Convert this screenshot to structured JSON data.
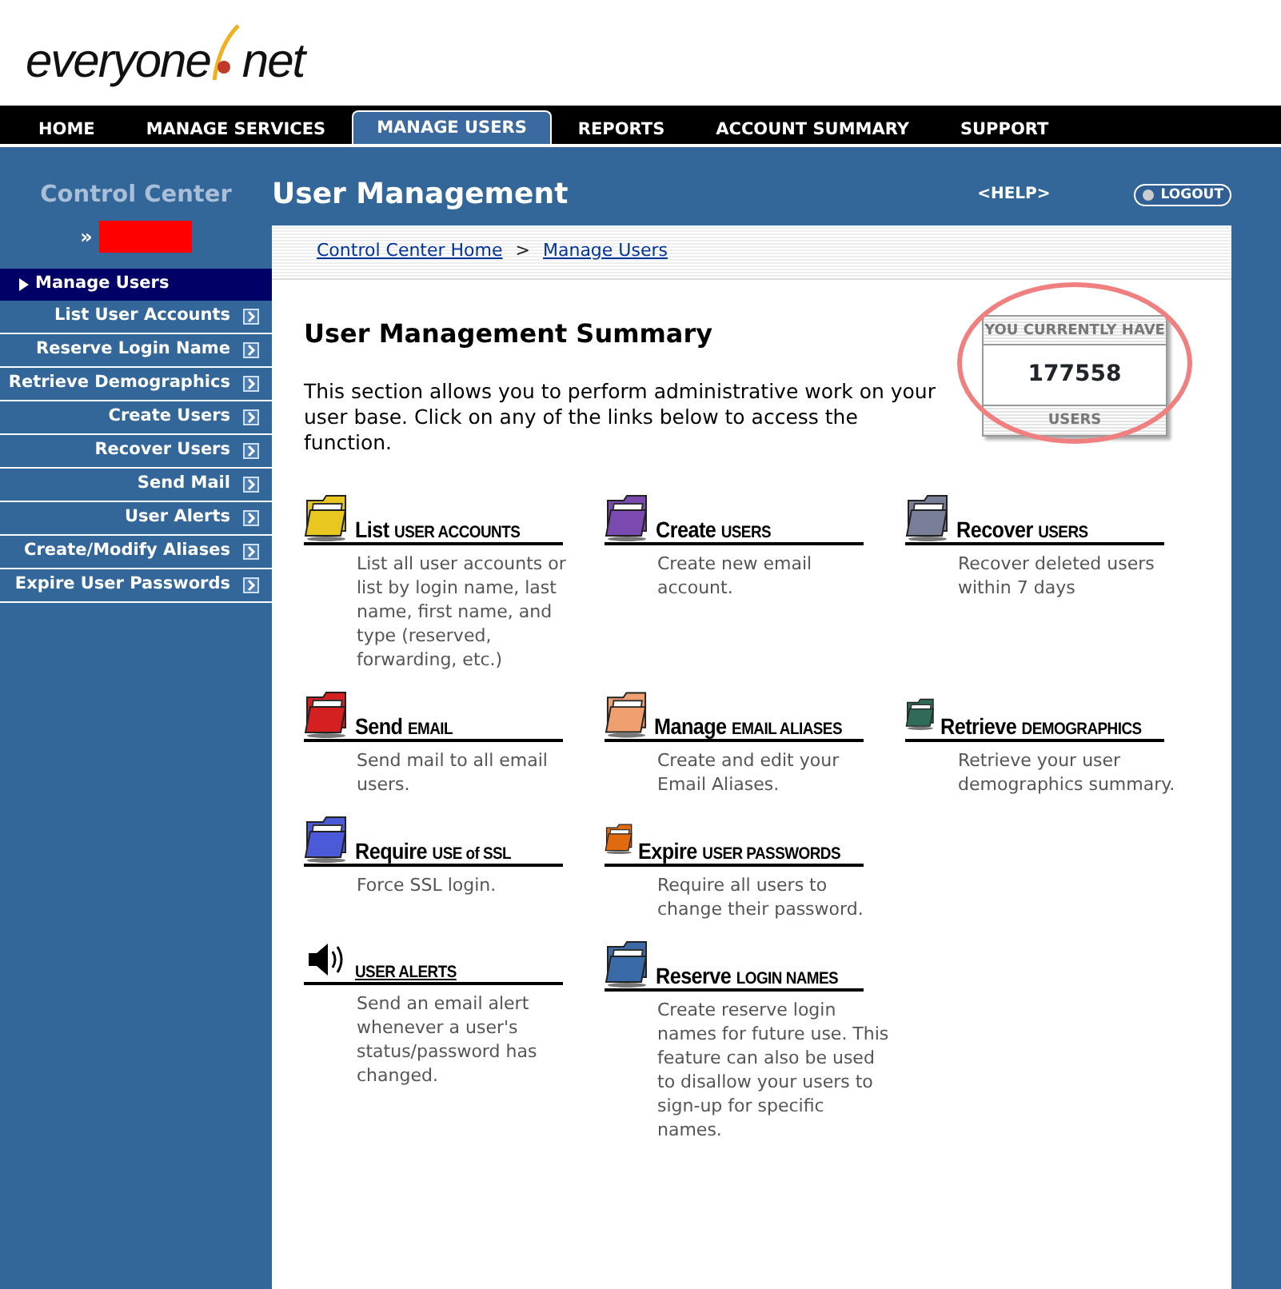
{
  "logo": {
    "text": "everyone",
    "suffix": "net"
  },
  "nav_tabs": [
    {
      "label": "HOME",
      "selected": false
    },
    {
      "label": "MANAGE SERVICES",
      "selected": false
    },
    {
      "label": "MANAGE USERS",
      "selected": true
    },
    {
      "label": "REPORTS",
      "selected": false
    },
    {
      "label": "ACCOUNT SUMMARY",
      "selected": false
    },
    {
      "label": "SUPPORT",
      "selected": false
    }
  ],
  "sidebar": {
    "title": "Control Center",
    "user_prefix": "»",
    "section": "Manage Users",
    "items": [
      {
        "label": "List User Accounts"
      },
      {
        "label": "Reserve Login Name"
      },
      {
        "label": "Retrieve Demographics"
      },
      {
        "label": "Create Users"
      },
      {
        "label": "Recover Users"
      },
      {
        "label": "Send Mail"
      },
      {
        "label": "User Alerts"
      },
      {
        "label": "Create/Modify Aliases"
      },
      {
        "label": "Expire User Passwords"
      }
    ]
  },
  "header": {
    "title": "User Management",
    "help": "<HELP>",
    "logout": "LOGOUT"
  },
  "breadcrumb": {
    "links": [
      "Control Center Home",
      "Manage Users"
    ],
    "separator": ">"
  },
  "summary": {
    "title": "User Management Summary",
    "text": "This section allows you to perform administrative work on your user base. Click on any of the links below to access the function.",
    "counter": {
      "top": "YOU CURRENTLY HAVE",
      "value": "177558",
      "bottom": "USERS"
    }
  },
  "feature_rows": [
    [
      {
        "kind": "folder",
        "color": "#e8c820",
        "main": "List",
        "rest": "USER ACCOUNTS",
        "text": "List all user accounts or list by login name, last name, first name, and type (reserved, forwarding, etc.)"
      },
      {
        "kind": "folder",
        "color": "#7a4ab0",
        "main": "Create",
        "rest": "USERS",
        "text": "Create new email account."
      },
      {
        "kind": "folder",
        "color": "#7a7f99",
        "main": "Recover",
        "rest": "USERS",
        "text": "Recover deleted users within 7 days"
      }
    ],
    [
      {
        "kind": "folder",
        "color": "#d42020",
        "main": "Send",
        "rest": "EMAIL",
        "text": "Send mail to all email users."
      },
      {
        "kind": "folder",
        "color": "#f0a070",
        "main": "Manage",
        "rest": "EMAIL ALIASES",
        "text": "Create and edit your Email Aliases."
      },
      {
        "kind": "folder",
        "color": "#2f6a5a",
        "main": "Retrieve",
        "rest": "DEMOGRAPHICS",
        "text": "Retrieve your user demographics summary."
      }
    ],
    [
      {
        "kind": "folder",
        "color": "#4a5ad8",
        "main": "Require",
        "rest": "USE of SSL",
        "text": "Force SSL login."
      },
      {
        "kind": "folder",
        "color": "#e06a10",
        "main": "Expire",
        "rest": "USER PASSWORDS",
        "text": "Require all users to change their password."
      }
    ],
    [
      {
        "kind": "speaker",
        "rest": "USER ALERTS",
        "text": "Send an email alert whenever a user's status/password has changed."
      },
      {
        "kind": "folder",
        "color": "#3a6aa8",
        "main": "Reserve",
        "rest": "LOGIN NAMES",
        "text": "Create reserve login names for future use. This feature can also be used to disallow your users to sign-up for specific names."
      }
    ]
  ]
}
